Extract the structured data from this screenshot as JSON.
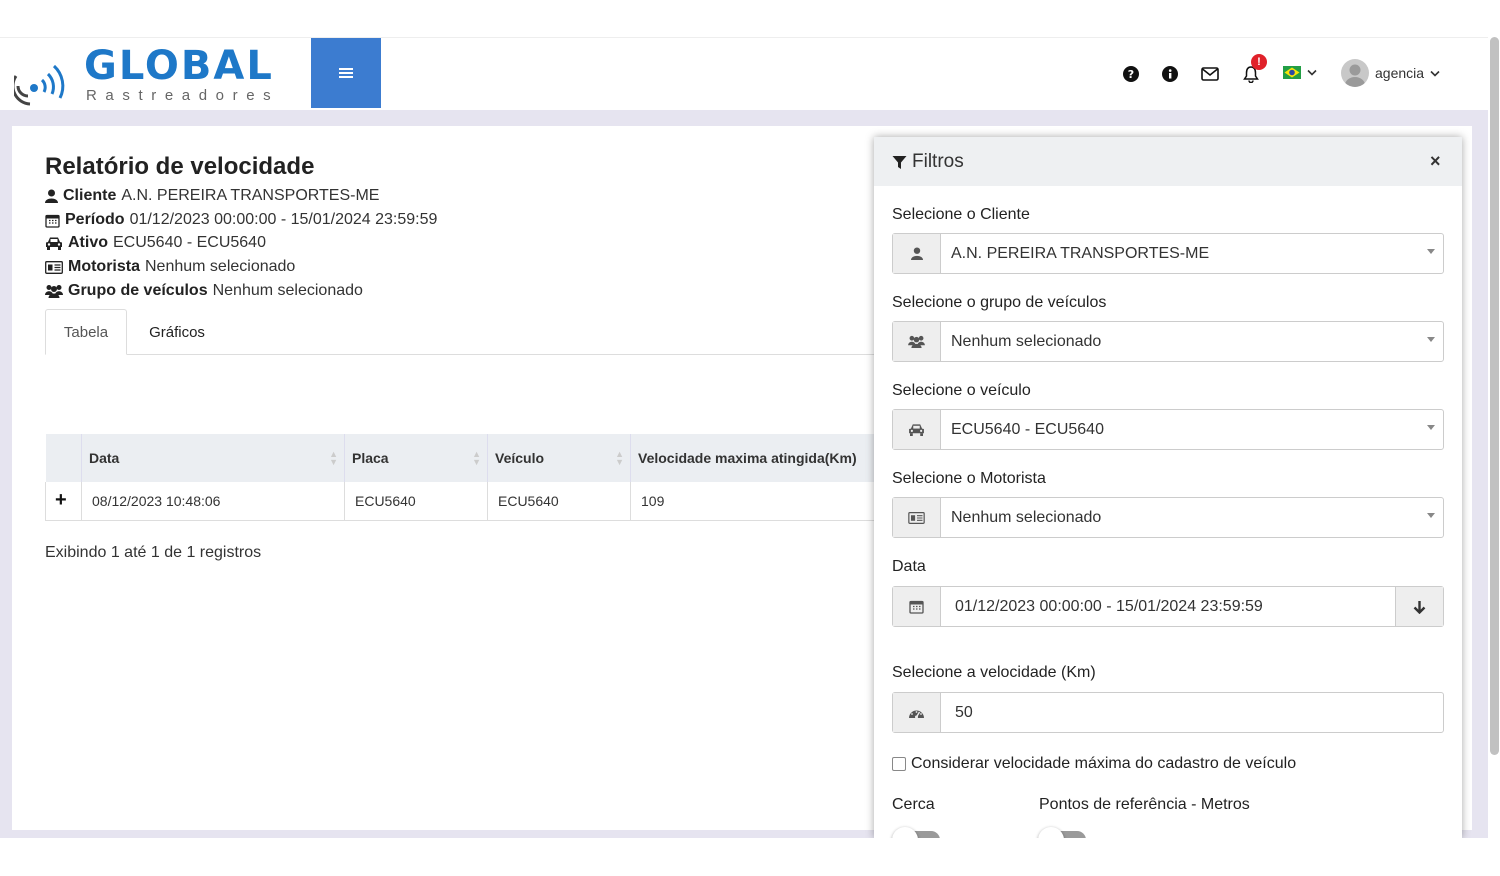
{
  "brand": {
    "name": "GLOBAL",
    "tagline": "Rastreadores",
    "accent": "#1e78c8",
    "menu_color": "#3c7cd0"
  },
  "header": {
    "notification_count": "!",
    "user_name": "agencia",
    "icons": [
      "question-icon",
      "info-icon",
      "envelope-icon",
      "bell-icon",
      "flag-brazil-icon"
    ]
  },
  "report": {
    "title": "Relatório de velocidade",
    "cliente_label": "Cliente",
    "cliente_value": "A.N. PEREIRA TRANSPORTES-ME",
    "periodo_label": "Período",
    "periodo_value": "01/12/2023 00:00:00 - 15/01/2024 23:59:59",
    "ativo_label": "Ativo",
    "ativo_value": "ECU5640 - ECU5640",
    "motorista_label": "Motorista",
    "motorista_value": "Nenhum selecionado",
    "grupo_label": "Grupo de veículos",
    "grupo_value": "Nenhum selecionado"
  },
  "tabs": [
    {
      "label": "Tabela"
    },
    {
      "label": "Gráficos"
    }
  ],
  "table": {
    "columns": [
      "Data",
      "Placa",
      "Veículo",
      "Velocidade maxima atingida(Km)"
    ],
    "rows": [
      {
        "expand": "+",
        "data": "08/12/2023 10:48:06",
        "placa": "ECU5640",
        "veiculo": "ECU5640",
        "velocidade": "109"
      }
    ],
    "footer": "Exibindo 1 até 1 de 1 registros"
  },
  "filters": {
    "title": "Filtros",
    "close": "×",
    "cliente_label": "Selecione o Cliente",
    "cliente_value": "A.N. PEREIRA TRANSPORTES-ME",
    "grupo_label": "Selecione o grupo de veículos",
    "grupo_value": "Nenhum selecionado",
    "veiculo_label": "Selecione o veículo",
    "veiculo_value": "ECU5640 - ECU5640",
    "motorista_label": "Selecione o Motorista",
    "motorista_value": "Nenhum selecionado",
    "data_label": "Data",
    "data_value": "01/12/2023 00:00:00 - 15/01/2024 23:59:59",
    "velocidade_label": "Selecione a velocidade (Km)",
    "velocidade_value": "50",
    "checkbox_label": "Considerar velocidade máxima do cadastro de veículo",
    "cerca_label": "Cerca",
    "pontos_label": "Pontos de referência - Metros"
  }
}
